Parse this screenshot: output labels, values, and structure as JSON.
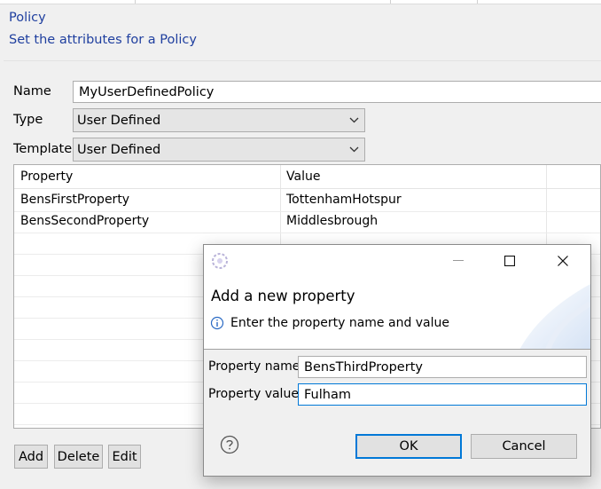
{
  "header": {
    "title": "Policy",
    "description": "Set the attributes for a Policy"
  },
  "form": {
    "name_label": "Name",
    "name_value": "MyUserDefinedPolicy",
    "type_label": "Type",
    "type_value": "User Defined",
    "template_label": "Template",
    "template_value": "User Defined"
  },
  "table": {
    "columns": [
      "Property",
      "Value"
    ],
    "rows": [
      {
        "property": "BensFirstProperty",
        "value": "TottenhamHotspur"
      },
      {
        "property": "BensSecondProperty",
        "value": "Middlesbrough"
      }
    ]
  },
  "buttons": {
    "add": "Add",
    "delete": "Delete",
    "edit": "Edit"
  },
  "dialog": {
    "title": "Add a new property",
    "message": "Enter the property name and value",
    "name_label": "Property name",
    "name_value": "BensThirdProperty",
    "value_label": "Property value",
    "value_value": "Fulham",
    "ok": "OK",
    "cancel": "Cancel",
    "window_buttons": [
      "minimize-icon",
      "maximize-icon",
      "close-icon"
    ]
  },
  "colors": {
    "link_blue": "#1f3f9f",
    "focus_blue": "#0078d7",
    "button_gray": "#e1e1e1"
  }
}
